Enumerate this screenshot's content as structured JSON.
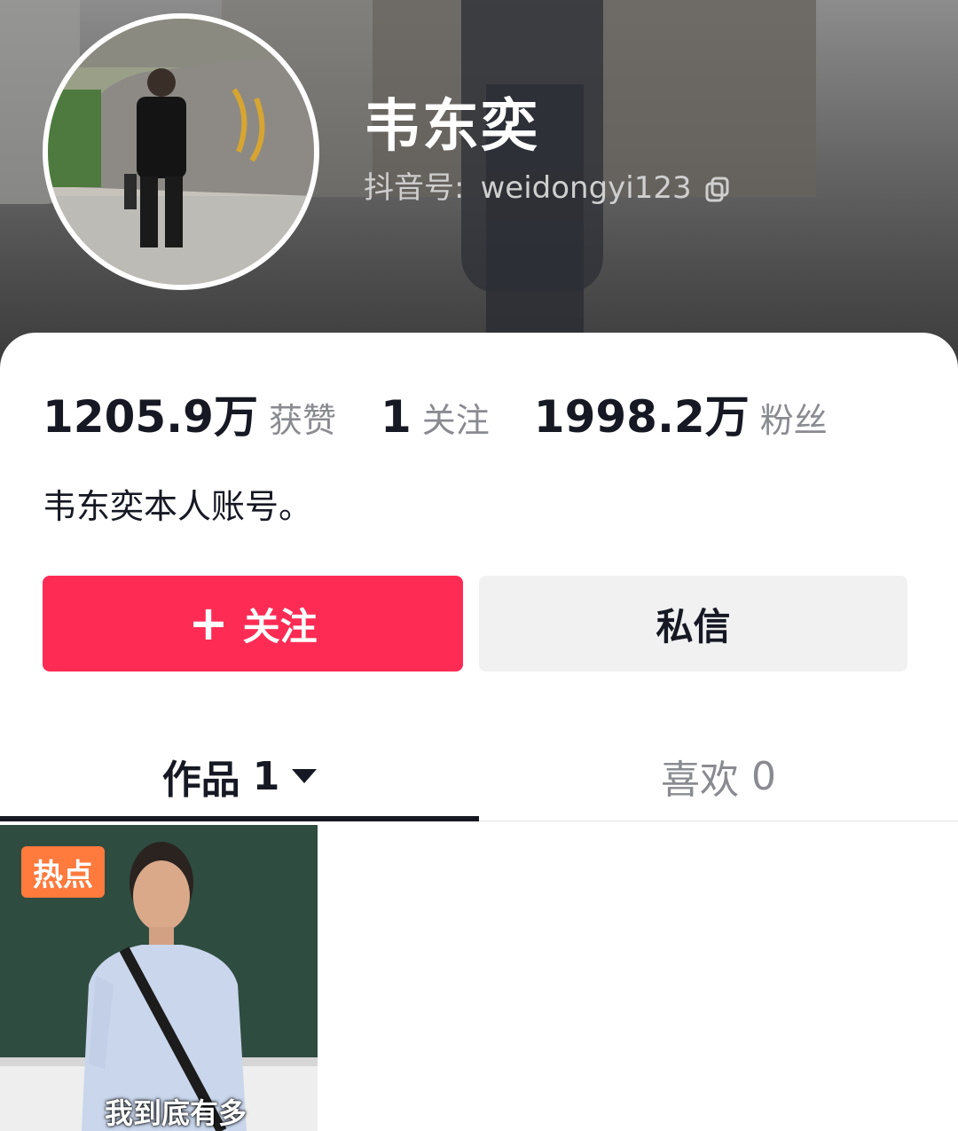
{
  "profile": {
    "name": "韦东奕",
    "douyin_id_label": "抖音号:",
    "douyin_id": "weidongyi123",
    "bio": "韦东奕本人账号。"
  },
  "stats": [
    {
      "value": "1205.9万",
      "label": "获赞"
    },
    {
      "value": "1",
      "label": "关注"
    },
    {
      "value": "1998.2万",
      "label": "粉丝"
    }
  ],
  "actions": {
    "follow_label": "关注",
    "message_label": "私信"
  },
  "tabs": {
    "works_label": "作品",
    "works_count": "1",
    "likes_label": "喜欢",
    "likes_count": "0"
  },
  "videos": [
    {
      "badge": "热点",
      "caption": "我到底有多"
    }
  ],
  "colors": {
    "follow_button": "#fe2c55",
    "hot_badge": "#ff7a3d",
    "message_button": "#f1f1f2"
  }
}
